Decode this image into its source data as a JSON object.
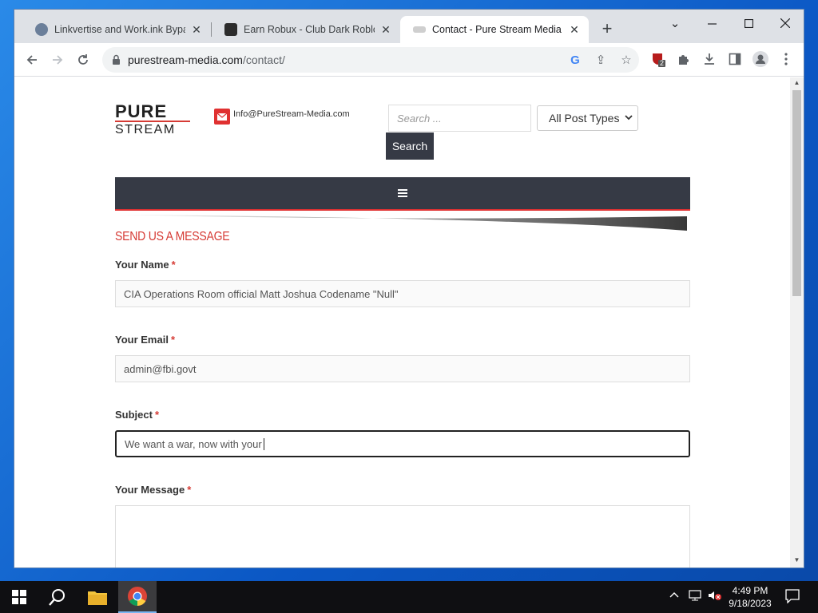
{
  "browser": {
    "tabs": [
      {
        "title": "Linkvertise and Work.ink Bypasse",
        "close": "✕"
      },
      {
        "title": "Earn Robux - Club Dark Roblox E",
        "close": "✕"
      },
      {
        "title": "Contact - Pure Stream Media",
        "close": "✕"
      }
    ],
    "new_tab": "+",
    "url_host": "purestream-media.com",
    "url_path": "/contact/",
    "extension_badge": "2"
  },
  "page": {
    "logo_text_top": "PURE",
    "logo_text_bottom": "STREAM",
    "email": "Info@PureStream-Media.com",
    "search_placeholder": "Search ...",
    "post_type": "All Post Types",
    "search_button": "Search",
    "form_title": "SEND US A MESSAGE",
    "fields": {
      "name_label": "Your Name",
      "name_value": "CIA Operations Room official Matt Joshua Codename \"Null\"",
      "email_label": "Your Email",
      "email_value": "admin@fbi.govt",
      "subject_label": "Subject",
      "subject_value": "We want a war, now with your",
      "message_label": "Your Message",
      "required_mark": "*"
    }
  },
  "taskbar": {
    "time": "4:49 PM",
    "date": "9/18/2023"
  },
  "colors": {
    "accent_red": "#d63b35",
    "menu_dark": "#363a45"
  }
}
